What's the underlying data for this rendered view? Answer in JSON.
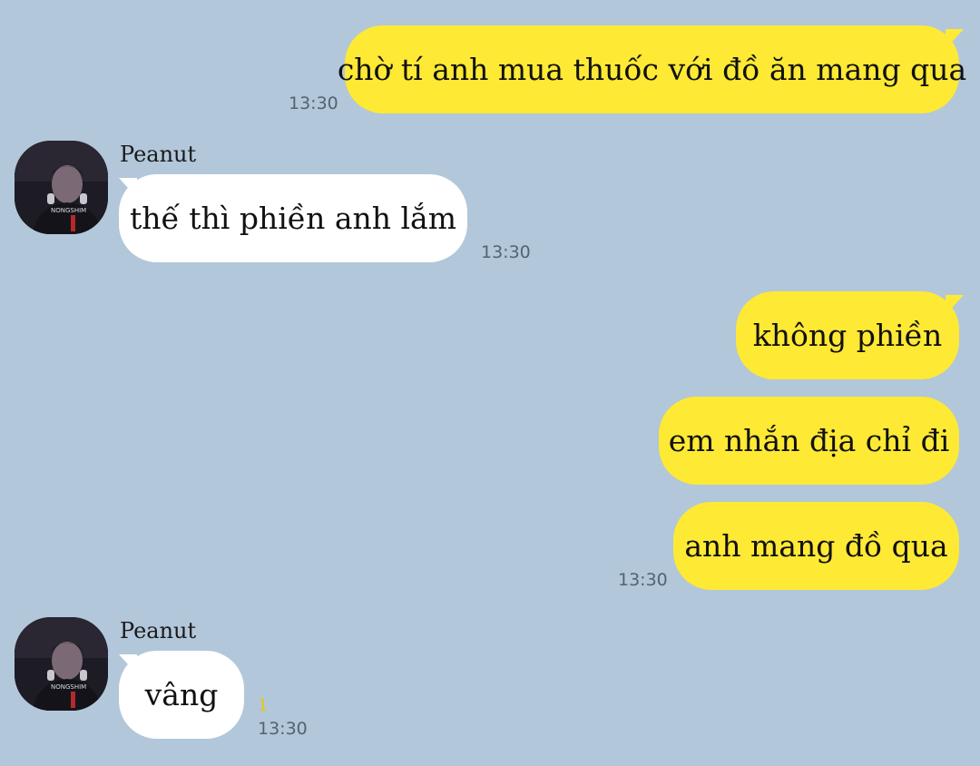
{
  "colors": {
    "background": "#b2c7da",
    "my_bubble": "#fee934",
    "their_bubble": "#ffffff",
    "timestamp": "#556270",
    "unread_badge": "#e8c61a"
  },
  "messages": [
    {
      "from": "me",
      "text": "chờ tí anh mua thuốc với đồ ăn mang qua",
      "time": "13:30"
    },
    {
      "from": "Peanut",
      "text": "thế thì phiền anh lắm",
      "time": "13:30",
      "avatar_icon": "person-avatar-icon"
    },
    {
      "from": "me",
      "text": "không phiền"
    },
    {
      "from": "me",
      "text": "em nhắn địa chỉ đi"
    },
    {
      "from": "me",
      "text": "anh mang đồ qua",
      "time": "13:30"
    },
    {
      "from": "Peanut",
      "text": "vâng",
      "time": "13:30",
      "unread": "1",
      "avatar_icon": "person-avatar-icon"
    }
  ],
  "avatar_jersey_text": "NONGSHIM"
}
